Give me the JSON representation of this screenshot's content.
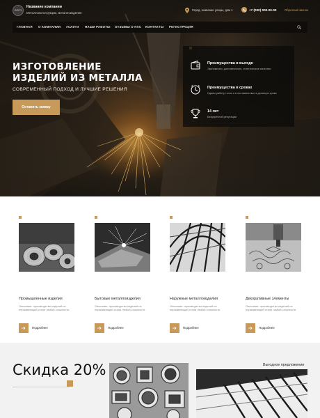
{
  "header": {
    "logo_text": "ЛОГО",
    "company_name": "Название компании",
    "company_sub": "Металлоконструкции, металлоизделия",
    "address": "Город, название улицы, дом 1",
    "phone": "+7 (000) 000-00-00",
    "callback": "Обратный звонок"
  },
  "nav": {
    "items": [
      "ГЛАВНАЯ",
      "О КОМПАНИИ",
      "УСЛУГИ",
      "НАШИ РАБОТЫ",
      "ОТЗЫВЫ О НАС",
      "КОНТАКТЫ",
      "РЕГИСТРАЦИЯ"
    ]
  },
  "hero": {
    "title_line1": "ИЗГОТОВЛЕНИЕ",
    "title_line2": "ИЗДЕЛИЙ ИЗ МЕТАЛЛА",
    "subtitle": "СОВРЕМЕННЫЙ ПОДХОД И ЛУЧШИЕ РЕШЕНИЯ",
    "button": "Оставить заявку"
  },
  "advantages": [
    {
      "icon": "wallet-icon",
      "title": "Преимущества в выгоде",
      "text": "Экономично, долговечность, эстетическое качество"
    },
    {
      "icon": "clock-icon",
      "title": "Преимущества в сроках",
      "text": "Сдаем работу точно и в поставленные в договоре сроки"
    },
    {
      "icon": "trophy-icon",
      "title": "14 лет",
      "text": "Безупречной репутации"
    }
  ],
  "products": [
    {
      "title": "Промышленные изделия",
      "desc": "Описание: производство изделий из нержавеющей стали любой сложности",
      "link": "Подробнее"
    },
    {
      "title": "Бытовые металлоизделия",
      "desc": "Описание: производство изделий из нержавеющей стали любой сложности",
      "link": "Подробнее"
    },
    {
      "title": "Наружные металлоизделия",
      "desc": "Описание: производство изделий из нержавеющей стали любой сложности",
      "link": "Подробнее"
    },
    {
      "title": "Декоративные элементы",
      "desc": "Описание: производство изделий из нержавеющей стали любой сложности",
      "link": "Подробнее"
    }
  ],
  "promo": {
    "title": "Скидка 20%",
    "label": "Выгодное предложение"
  },
  "colors": {
    "accent": "#c89a5a",
    "dark": "#1b1712"
  }
}
